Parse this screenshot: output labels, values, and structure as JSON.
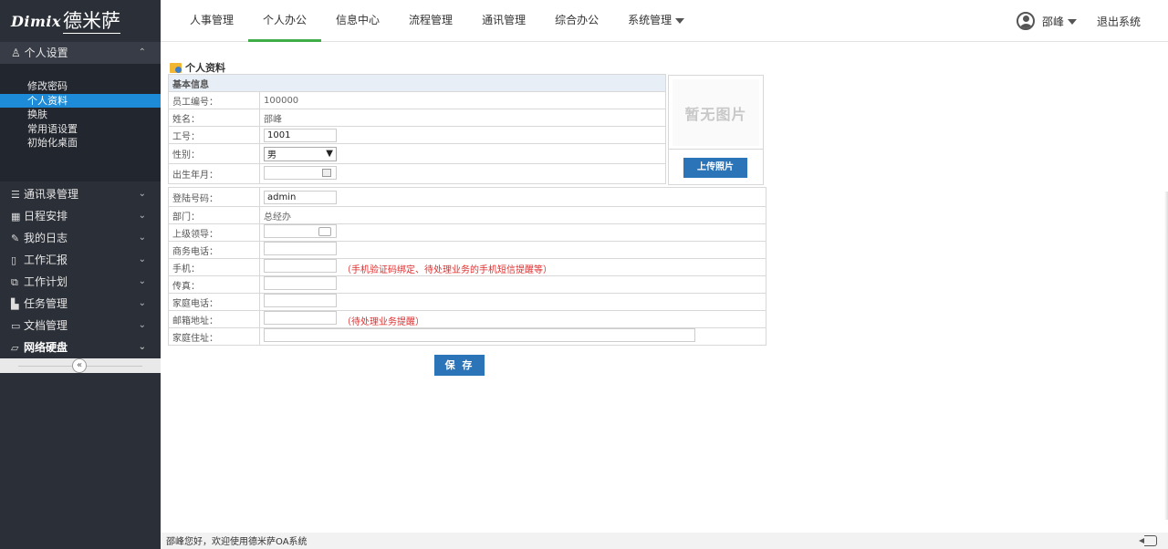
{
  "logo": {
    "brand": "Dimix",
    "cn": "德米萨"
  },
  "nav": [
    {
      "label": "人事管理"
    },
    {
      "label": "个人办公",
      "active": true
    },
    {
      "label": "信息中心"
    },
    {
      "label": "流程管理"
    },
    {
      "label": "通讯管理"
    },
    {
      "label": "综合办公"
    },
    {
      "label": "系统管理"
    }
  ],
  "user": {
    "name": "邵峰",
    "logout": "退出系统"
  },
  "sidebar": {
    "group_title": "个人设置",
    "group_icon": "user-settings-icon",
    "sub_items": [
      "修改密码",
      "个人资料",
      "换肤",
      "常用语设置",
      "初始化桌面"
    ],
    "active_sub": "个人资料",
    "menu": [
      {
        "label": "通讯录管理",
        "icon": "list-icon"
      },
      {
        "label": "日程安排",
        "icon": "calendar-icon"
      },
      {
        "label": "我的日志",
        "icon": "pencil-icon"
      },
      {
        "label": "工作汇报",
        "icon": "document-icon"
      },
      {
        "label": "工作计划",
        "icon": "plan-icon"
      },
      {
        "label": "任务管理",
        "icon": "task-icon"
      },
      {
        "label": "文档管理",
        "icon": "folder-icon"
      },
      {
        "label": "网络硬盘",
        "icon": "folder-open-icon"
      }
    ],
    "collapse_glyph": "«"
  },
  "page": {
    "title": "个人资料",
    "section": "基本信息",
    "photo_placeholder": "暂无图片",
    "upload_label": "上传照片",
    "save_label": "保 存",
    "fields": {
      "emp_no_label": "员工编号：",
      "emp_no": "100000",
      "name_label": "姓名：",
      "name": "邵峰",
      "work_no_label": "工号：",
      "work_no": "1001",
      "gender_label": "性别：",
      "gender": "男",
      "birth_label": "出生年月：",
      "birth": "",
      "login_label": "登陆号码：",
      "login": "admin",
      "dept_label": "部门：",
      "dept": "总经办",
      "leader_label": "上级领导：",
      "leader": "",
      "biz_phone_label": "商务电话：",
      "biz_phone": "",
      "mobile_label": "手机：",
      "mobile": "",
      "mobile_note": "（手机验证码绑定、待处理业务的手机短信提醒等）",
      "fax_label": "传真：",
      "fax": "",
      "home_phone_label": "家庭电话：",
      "home_phone": "",
      "email_label": "邮箱地址：",
      "email": "",
      "email_note": "（待处理业务提醒）",
      "address_label": "家庭住址：",
      "address": ""
    }
  },
  "footer": {
    "welcome": "邵峰您好，欢迎使用德米萨OA系统"
  }
}
